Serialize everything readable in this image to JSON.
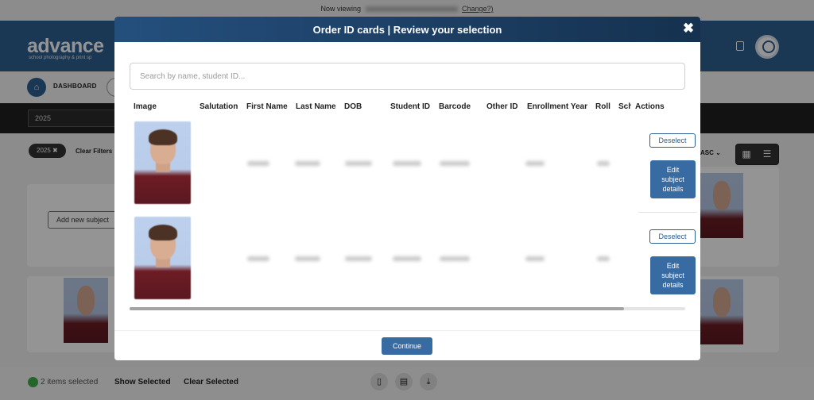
{
  "topbar": {
    "prefix": "Now viewing",
    "change": "Change?)"
  },
  "brand": {
    "name": "advance",
    "tagline": "school photography & print sp"
  },
  "breadcrumb": {
    "label": "DASHBOARD"
  },
  "filters": {
    "year_value": "2025",
    "chip_label": "2025 ✖",
    "clear_filters": "Clear Filters",
    "sort_label": "ASC ⌄"
  },
  "background": {
    "add_subject": "Add new subject"
  },
  "selection": {
    "count_text": "2 items selected",
    "show_selected": "Show Selected",
    "clear_selected": "Clear Selected"
  },
  "modal": {
    "title": "Order ID cards | Review your selection",
    "close_label": "✖",
    "search_placeholder": "Search by name, student ID...",
    "columns": [
      "Image",
      "Salutation",
      "First Name",
      "Last Name",
      "DOB",
      "Student ID",
      "Barcode",
      "Other ID",
      "Enrollment Year",
      "Roll",
      "Sch",
      "Actions"
    ],
    "rows": [
      {
        "deselect_label": "Deselect",
        "edit_label_1": "Edit",
        "edit_label_2": "subject",
        "edit_label_3": "details"
      },
      {
        "deselect_label": "Deselect",
        "edit_label_1": "Edit",
        "edit_label_2": "subject",
        "edit_label_3": "details"
      }
    ],
    "continue_label": "Continue"
  },
  "icons": [
    "home-icon",
    "document-icon",
    "avatar-icon",
    "close-icon",
    "grid-view-icon",
    "list-view-icon",
    "id-card-icon",
    "download-icon"
  ]
}
